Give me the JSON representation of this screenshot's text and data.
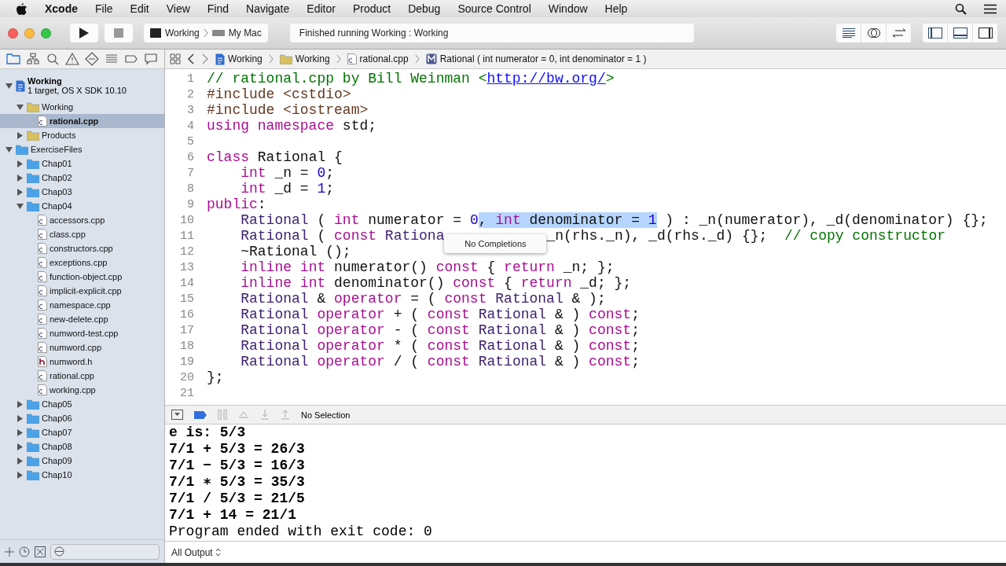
{
  "menubar": {
    "app": "Xcode",
    "menus": [
      "File",
      "Edit",
      "View",
      "Find",
      "Navigate",
      "Editor",
      "Product",
      "Debug",
      "Source Control",
      "Window",
      "Help"
    ]
  },
  "toolbar": {
    "scheme": "Working",
    "destination": "My Mac",
    "status": "Finished running Working : Working"
  },
  "navigator": {
    "tabs": [
      {
        "selected": true
      },
      {
        "selected": false
      },
      {
        "selected": false
      },
      {
        "selected": false
      },
      {
        "selected": false
      },
      {
        "selected": false
      },
      {
        "selected": false
      },
      {
        "selected": false
      }
    ],
    "tree": [
      {
        "label": "Working",
        "subtitle": "1 target, OS X SDK 10.10",
        "kind": "project",
        "expanded": true,
        "selected": false,
        "children": [
          {
            "label": "Working",
            "kind": "group",
            "expanded": true,
            "selected": false,
            "children": [
              {
                "label": "rational.cpp",
                "kind": "file",
                "selected": true
              }
            ]
          },
          {
            "label": "Products",
            "kind": "group",
            "expanded": false,
            "selected": false
          }
        ]
      },
      {
        "label": "ExerciseFiles",
        "kind": "folder",
        "expanded": true,
        "selected": false,
        "children": [
          {
            "label": "Chap01",
            "kind": "folder",
            "expanded": false,
            "selected": false
          },
          {
            "label": "Chap02",
            "kind": "folder",
            "expanded": false,
            "selected": false
          },
          {
            "label": "Chap03",
            "kind": "folder",
            "expanded": false,
            "selected": false
          },
          {
            "label": "Chap04",
            "kind": "folder",
            "expanded": true,
            "selected": false,
            "children": [
              {
                "label": "accessors.cpp",
                "kind": "file",
                "selected": false
              },
              {
                "label": "class.cpp",
                "kind": "file",
                "selected": false
              },
              {
                "label": "constructors.cpp",
                "kind": "file",
                "selected": false
              },
              {
                "label": "exceptions.cpp",
                "kind": "file",
                "selected": false
              },
              {
                "label": "function-object.cpp",
                "kind": "file",
                "selected": false
              },
              {
                "label": "implicit-explicit.cpp",
                "kind": "file",
                "selected": false
              },
              {
                "label": "namespace.cpp",
                "kind": "file",
                "selected": false
              },
              {
                "label": "new-delete.cpp",
                "kind": "file",
                "selected": false
              },
              {
                "label": "numword-test.cpp",
                "kind": "file",
                "selected": false
              },
              {
                "label": "numword.cpp",
                "kind": "file",
                "selected": false
              },
              {
                "label": "numword.h",
                "kind": "header",
                "selected": false
              },
              {
                "label": "rational.cpp",
                "kind": "file",
                "selected": false
              },
              {
                "label": "working.cpp",
                "kind": "file",
                "selected": false
              }
            ]
          },
          {
            "label": "Chap05",
            "kind": "folder",
            "expanded": false,
            "selected": false
          },
          {
            "label": "Chap06",
            "kind": "folder",
            "expanded": false,
            "selected": false
          },
          {
            "label": "Chap07",
            "kind": "folder",
            "expanded": false,
            "selected": false
          },
          {
            "label": "Chap08",
            "kind": "folder",
            "expanded": false,
            "selected": false
          },
          {
            "label": "Chap09",
            "kind": "folder",
            "expanded": false,
            "selected": false
          },
          {
            "label": "Chap10",
            "kind": "folder",
            "expanded": false,
            "selected": false
          }
        ]
      }
    ]
  },
  "jumpbar": [
    {
      "label": "Working",
      "kind": "project"
    },
    {
      "label": "Working",
      "kind": "group"
    },
    {
      "label": "rational.cpp",
      "kind": "file"
    },
    {
      "label": "Rational ( int numerator = 0, int denominator = 1 )",
      "kind": "method"
    }
  ],
  "editor": {
    "lines": [
      {
        "number": "1",
        "indented": false,
        "segments": [
          {
            "text": "// rational.cpp by Bill Weinman <",
            "kind": "comment"
          },
          {
            "text": "http://bw.org/",
            "kind": "link"
          },
          {
            "text": ">",
            "kind": "comment"
          }
        ]
      },
      {
        "number": "2",
        "indented": false,
        "segments": [
          {
            "text": "#include <cstdio>",
            "kind": "pre"
          }
        ]
      },
      {
        "number": "3",
        "indented": false,
        "segments": [
          {
            "text": "#include <iostream>",
            "kind": "pre"
          }
        ]
      },
      {
        "number": "4",
        "indented": false,
        "segments": [
          {
            "text": "using ",
            "kind": "kw"
          },
          {
            "text": "namespace",
            "kind": "kw"
          },
          {
            "text": " std;",
            "kind": "plain"
          }
        ]
      },
      {
        "number": "5"
      },
      {
        "number": "6",
        "indented": false,
        "segments": [
          {
            "text": "class",
            "kind": "kw"
          },
          {
            "text": " Rational {",
            "kind": "plain"
          }
        ]
      },
      {
        "number": "7",
        "indented": true,
        "segments": [
          {
            "text": "int",
            "kind": "kw"
          },
          {
            "text": " _n = ",
            "kind": "plain"
          },
          {
            "text": "0",
            "kind": "num"
          },
          {
            "text": ";",
            "kind": "plain"
          }
        ]
      },
      {
        "number": "8",
        "indented": true,
        "segments": [
          {
            "text": "int",
            "kind": "kw"
          },
          {
            "text": " _d = ",
            "kind": "plain"
          },
          {
            "text": "1",
            "kind": "num"
          },
          {
            "text": ";",
            "kind": "plain"
          }
        ]
      },
      {
        "number": "9",
        "indented": false,
        "segments": [
          {
            "text": "public",
            "kind": "kw"
          },
          {
            "text": ":",
            "kind": "plain"
          }
        ]
      },
      {
        "number": "10",
        "indented": true,
        "segments": [
          {
            "text": "Rational",
            "kind": "type",
            "highlighted": false
          },
          {
            "text": " ( ",
            "kind": "plain",
            "highlighted": false
          },
          {
            "text": "int",
            "kind": "kw",
            "highlighted": false
          },
          {
            "text": " numerator = ",
            "kind": "plain",
            "highlighted": false
          },
          {
            "text": "0",
            "kind": "num",
            "highlighted": false
          },
          {
            "text": ", ",
            "kind": "plain",
            "highlighted": true
          },
          {
            "text": "int",
            "kind": "kw",
            "highlighted": true
          },
          {
            "text": " denominator = ",
            "kind": "plain",
            "highlighted": true
          },
          {
            "text": "1",
            "kind": "num",
            "highlighted": true
          },
          {
            "text": " ) : _n(numerator), _d(denominator) {};",
            "kind": "plain",
            "highlighted": false
          }
        ]
      },
      {
        "number": "11",
        "indented": true,
        "segments": [
          {
            "text": "Rational",
            "kind": "type"
          },
          {
            "text": " ( ",
            "kind": "plain"
          },
          {
            "text": "const ",
            "kind": "kw"
          },
          {
            "text": "Rationa",
            "kind": "type"
          },
          {
            "text": "No Completions",
            "kind": "popup"
          },
          {
            "text": "_n(rhs._n), _d(rhs._d) {};  ",
            "kind": "plain"
          },
          {
            "text": "// copy constructor",
            "kind": "comment"
          }
        ]
      },
      {
        "number": "12",
        "indented": true,
        "segments": [
          {
            "text": "~Rational ();",
            "kind": "plain"
          }
        ]
      },
      {
        "number": "13",
        "indented": true,
        "segments": [
          {
            "text": "inline ",
            "kind": "kw"
          },
          {
            "text": "int",
            "kind": "kw"
          },
          {
            "text": " numerator() ",
            "kind": "plain"
          },
          {
            "text": "const",
            "kind": "kw"
          },
          {
            "text": " { ",
            "kind": "plain"
          },
          {
            "text": "return",
            "kind": "kw"
          },
          {
            "text": " _n; };",
            "kind": "plain"
          }
        ]
      },
      {
        "number": "14",
        "indented": true,
        "segments": [
          {
            "text": "inline ",
            "kind": "kw"
          },
          {
            "text": "int",
            "kind": "kw"
          },
          {
            "text": " denominator() ",
            "kind": "plain"
          },
          {
            "text": "const",
            "kind": "kw"
          },
          {
            "text": " { ",
            "kind": "plain"
          },
          {
            "text": "return",
            "kind": "kw"
          },
          {
            "text": " _d; };",
            "kind": "plain"
          }
        ]
      },
      {
        "number": "15",
        "indented": true,
        "segments": [
          {
            "text": "Rational",
            "kind": "type"
          },
          {
            "text": " & ",
            "kind": "plain"
          },
          {
            "text": "operator",
            "kind": "kw"
          },
          {
            "text": " = ( ",
            "kind": "plain"
          },
          {
            "text": "const ",
            "kind": "kw"
          },
          {
            "text": "Rational",
            "kind": "type"
          },
          {
            "text": " & );",
            "kind": "plain"
          }
        ]
      },
      {
        "number": "16",
        "indented": true,
        "segments": [
          {
            "text": "Rational ",
            "kind": "type"
          },
          {
            "text": "operator",
            "kind": "kw"
          },
          {
            "text": " + ( ",
            "kind": "plain"
          },
          {
            "text": "const ",
            "kind": "kw"
          },
          {
            "text": "Rational",
            "kind": "type"
          },
          {
            "text": " & ) ",
            "kind": "plain"
          },
          {
            "text": "const",
            "kind": "kw"
          },
          {
            "text": ";",
            "kind": "plain"
          }
        ]
      },
      {
        "number": "17",
        "indented": true,
        "segments": [
          {
            "text": "Rational ",
            "kind": "type"
          },
          {
            "text": "operator",
            "kind": "kw"
          },
          {
            "text": " - ( ",
            "kind": "plain"
          },
          {
            "text": "const ",
            "kind": "kw"
          },
          {
            "text": "Rational",
            "kind": "type"
          },
          {
            "text": " & ) ",
            "kind": "plain"
          },
          {
            "text": "const",
            "kind": "kw"
          },
          {
            "text": ";",
            "kind": "plain"
          }
        ]
      },
      {
        "number": "18",
        "indented": true,
        "segments": [
          {
            "text": "Rational ",
            "kind": "type"
          },
          {
            "text": "operator",
            "kind": "kw"
          },
          {
            "text": " * ( ",
            "kind": "plain"
          },
          {
            "text": "const ",
            "kind": "kw"
          },
          {
            "text": "Rational",
            "kind": "type"
          },
          {
            "text": " & ) ",
            "kind": "plain"
          },
          {
            "text": "const",
            "kind": "kw"
          },
          {
            "text": ";",
            "kind": "plain"
          }
        ]
      },
      {
        "number": "19",
        "indented": true,
        "segments": [
          {
            "text": "Rational ",
            "kind": "type"
          },
          {
            "text": "operator",
            "kind": "kw"
          },
          {
            "text": " / ( ",
            "kind": "plain"
          },
          {
            "text": "const ",
            "kind": "kw"
          },
          {
            "text": "Rational",
            "kind": "type"
          },
          {
            "text": " & ) ",
            "kind": "plain"
          },
          {
            "text": "const",
            "kind": "kw"
          },
          {
            "text": ";",
            "kind": "plain"
          }
        ]
      },
      {
        "number": "20",
        "indented": false,
        "segments": [
          {
            "text": "};",
            "kind": "plain"
          }
        ]
      },
      {
        "number": "21"
      }
    ]
  },
  "debug_bar": {
    "breakpoints_on": true,
    "selection": "No Selection"
  },
  "console": {
    "lines": [
      "e is: 5/3",
      "7/1 + 5/3 = 26/3",
      "7/1 − 5/3 = 16/3",
      "7/1 ∗ 5/3 = 35/3",
      "7/1 / 5/3 = 21/5",
      "7/1 + 14 = 21/1",
      "Program ended with exit code: 0"
    ],
    "output_filter": "All Output"
  }
}
